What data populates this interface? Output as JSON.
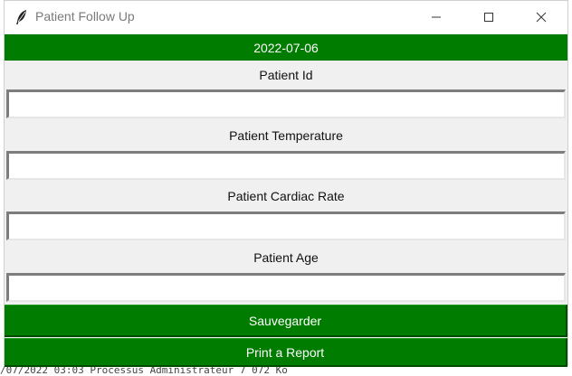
{
  "window": {
    "title": "Patient Follow Up",
    "icon": "feather-icon",
    "controls": [
      "minimize-icon",
      "maximize-icon",
      "close-icon"
    ]
  },
  "header": {
    "date": "2022-07-06"
  },
  "form": {
    "fields": [
      {
        "label": "Patient Id",
        "value": ""
      },
      {
        "label": "Patient Temperature",
        "value": ""
      },
      {
        "label": "Patient Cardiac Rate",
        "value": ""
      },
      {
        "label": "Patient Age",
        "value": ""
      }
    ]
  },
  "actions": {
    "save_label": "Sauvegarder",
    "report_label": "Print a Report"
  },
  "background": {
    "status_line": "/07/2022 03:03              Processus Administrateur    7 072 Ko"
  },
  "colors": {
    "accent": "#007c00",
    "window_bg": "#f0f0f0"
  }
}
